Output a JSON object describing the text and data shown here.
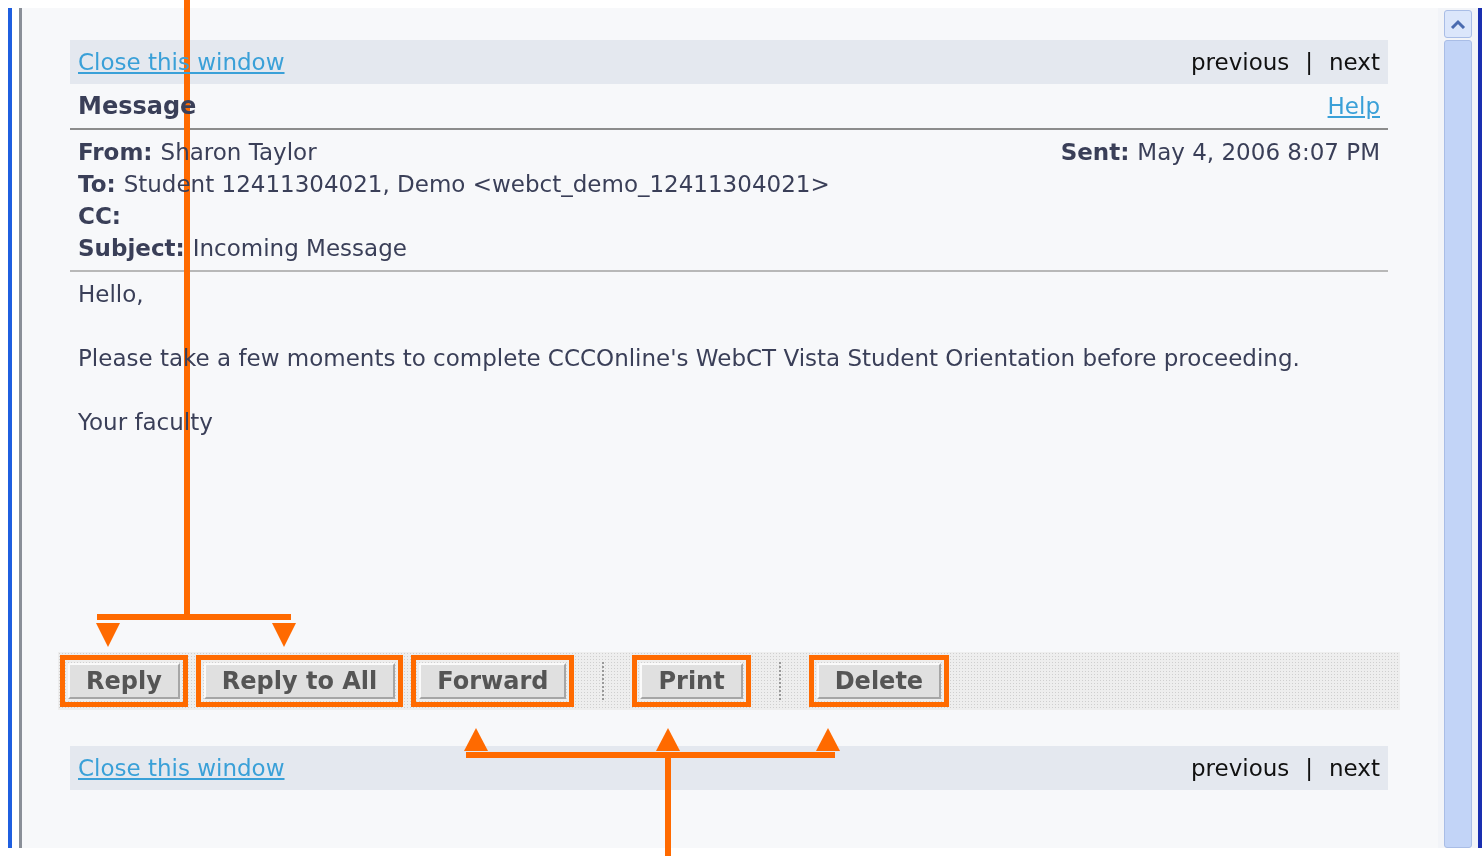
{
  "top_bar": {
    "close_link": "Close this window",
    "previous": "previous",
    "separator": "|",
    "next": "next"
  },
  "header": {
    "title": "Message",
    "help": "Help"
  },
  "fields": [
    {
      "label": "From:",
      "value": "Sharon Taylor"
    },
    {
      "label": "To:",
      "value": "Student 12411304021, Demo <webct_demo_12411304021>"
    },
    {
      "label": "CC:"
    },
    {
      "label": "Subject:",
      "value": "Incoming Message"
    }
  ],
  "sent": {
    "label": "Sent:",
    "value": "May 4, 2006 8:07 PM"
  },
  "body": [
    "Hello,",
    "Please take a few moments to complete CCCOnline's WebCT Vista Student Orientation before proceeding.",
    "Your faculty"
  ],
  "toolbar": [
    {
      "kind": "button",
      "label": "Reply",
      "highlighted": true
    },
    {
      "kind": "button",
      "label": "Reply to All",
      "highlighted": true
    },
    {
      "kind": "button",
      "label": "Forward",
      "highlighted": true
    },
    {
      "kind": "separator"
    },
    {
      "kind": "button",
      "label": "Print",
      "highlighted": true
    },
    {
      "kind": "separator"
    },
    {
      "kind": "button",
      "label": "Delete",
      "highlighted": true
    }
  ],
  "bottom_bar": {
    "close_link": "Close this window",
    "previous": "previous",
    "separator": "|",
    "next": "next"
  }
}
